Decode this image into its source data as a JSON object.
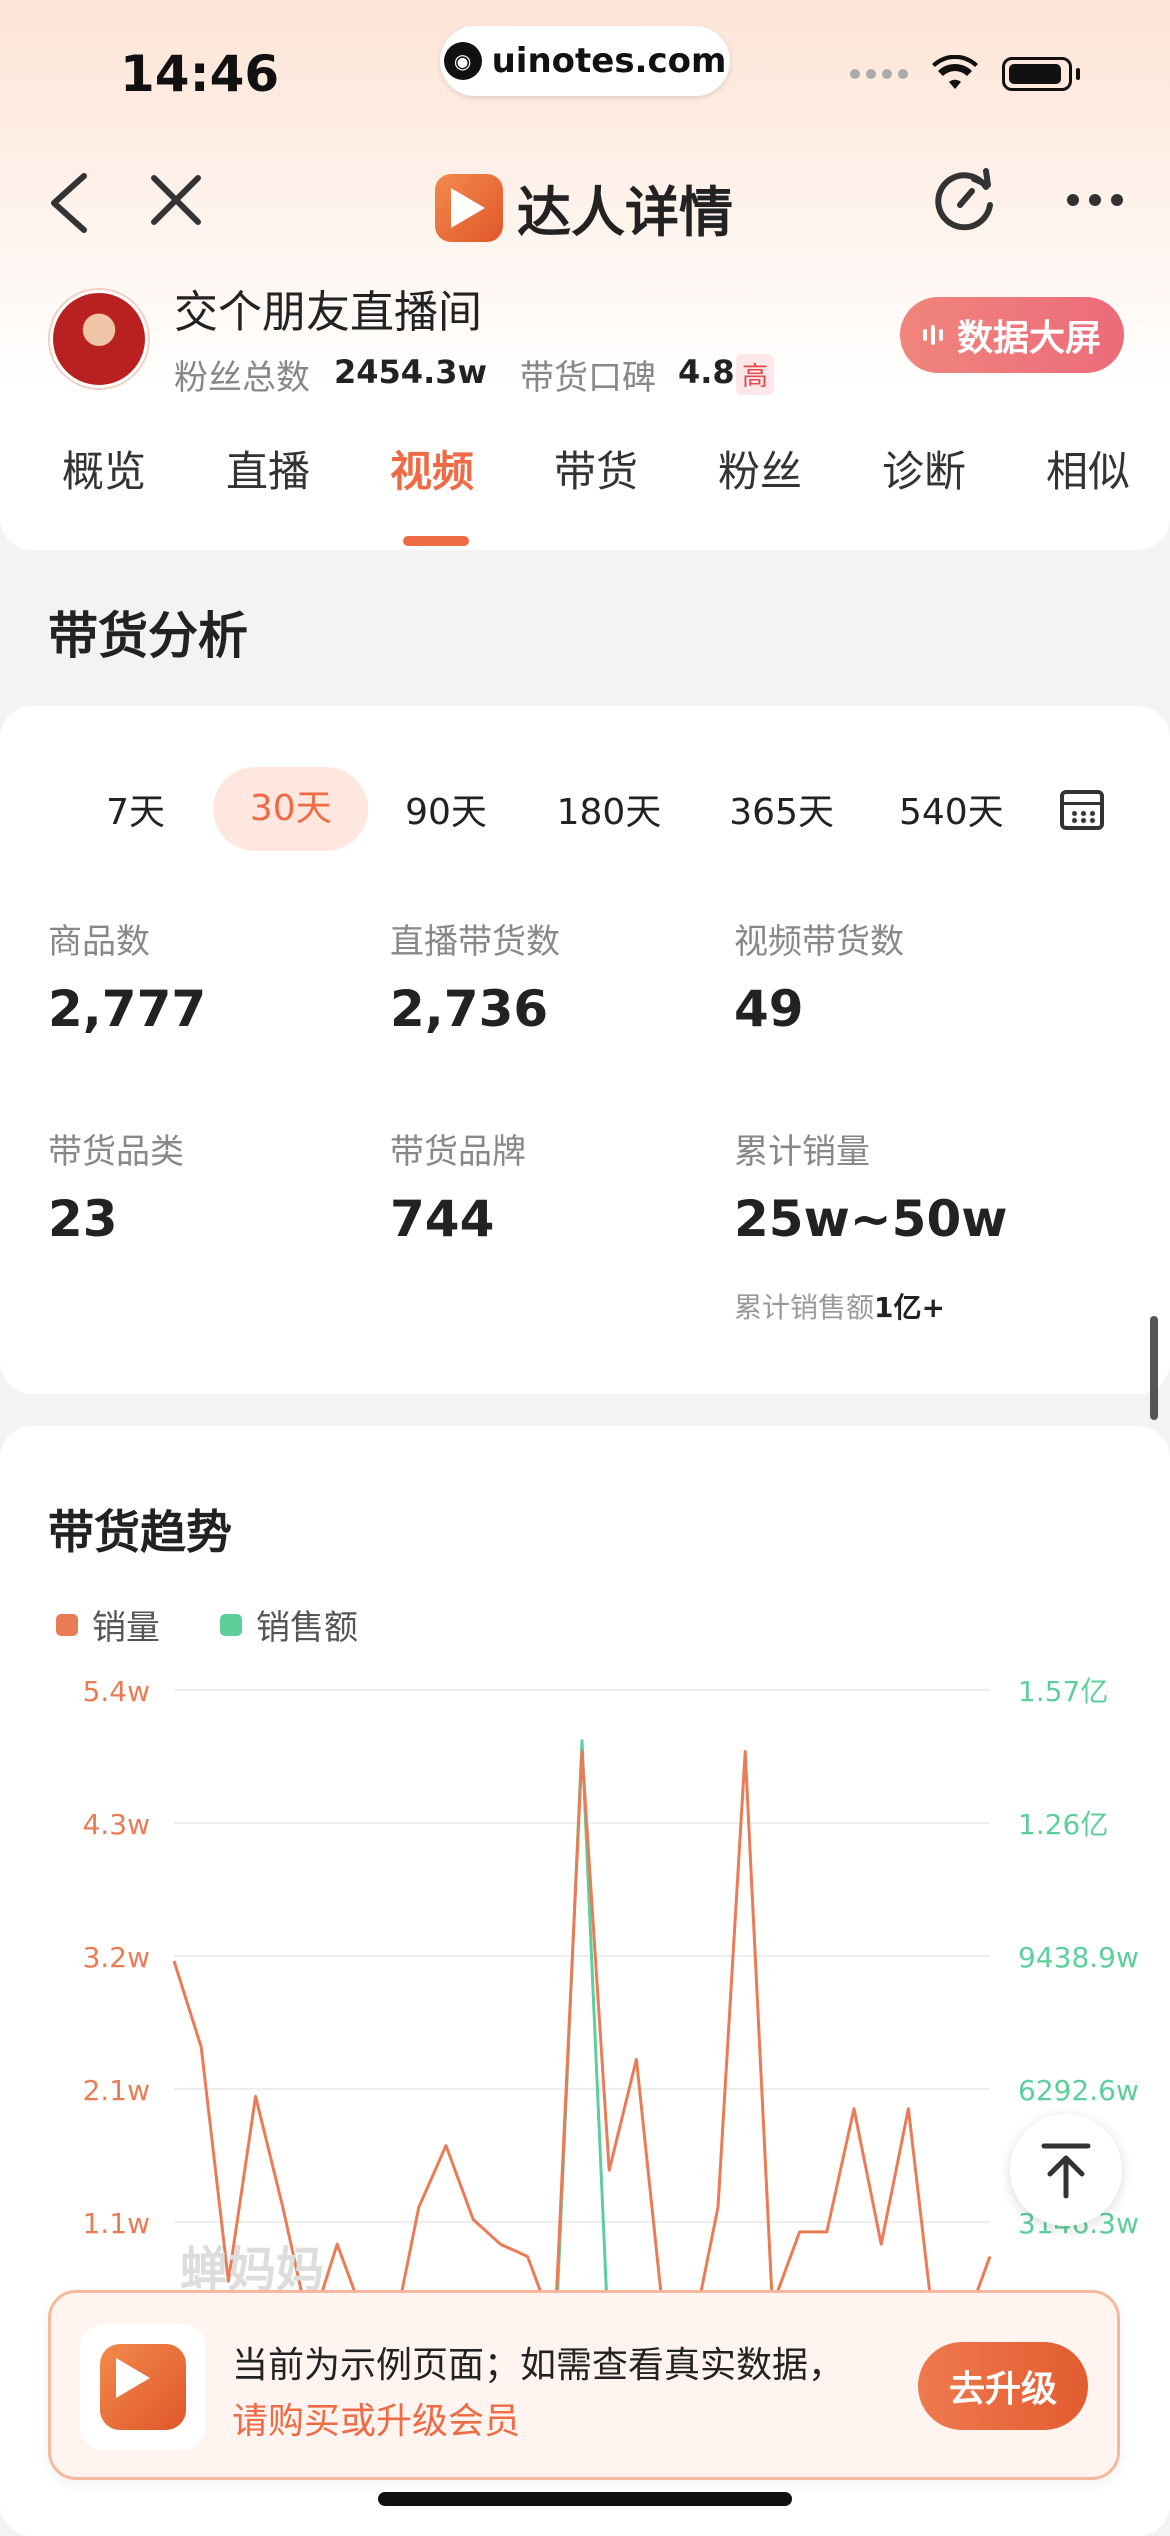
{
  "status_bar": {
    "time": "14:46",
    "url": "uinotes.com"
  },
  "nav": {
    "title": "达人详情"
  },
  "profile": {
    "name": "交个朋友直播间",
    "fans_label": "粉丝总数",
    "fans_value": "2454.3w",
    "rep_label": "带货口碑",
    "rep_value": "4.8",
    "rep_badge": "高",
    "screen_button": "数据大屏"
  },
  "tabs": [
    "概览",
    "直播",
    "视频",
    "带货",
    "粉丝",
    "诊断",
    "相似"
  ],
  "section_title": "带货分析",
  "periods": [
    "7天",
    "30天",
    "90天",
    "180天",
    "365天",
    "540天"
  ],
  "stats": [
    {
      "label": "商品数",
      "value": "2,777"
    },
    {
      "label": "直播带货数",
      "value": "2,736"
    },
    {
      "label": "视频带货数",
      "value": "49"
    },
    {
      "label": "带货品类",
      "value": "23"
    },
    {
      "label": "带货品牌",
      "value": "744"
    },
    {
      "label": "累计销量",
      "value": "25w~50w"
    }
  ],
  "cumulative_sales_label": "累计销售额",
  "cumulative_sales_value": "1亿+",
  "trend": {
    "title": "带货趋势",
    "legend": [
      "销量",
      "销售额"
    ],
    "colors": {
      "volume": "#ea7c55",
      "amount": "#5ccf9b"
    }
  },
  "chart_data": {
    "type": "line",
    "y_left_ticks": [
      "5.4w",
      "4.3w",
      "3.2w",
      "2.1w",
      "1.1w"
    ],
    "y_right_ticks": [
      "1.57亿",
      "1.26亿",
      "9438.9w",
      "6292.6w",
      "3146.3w"
    ],
    "series": [
      {
        "name": "销量",
        "values": [
          3.2,
          2.5,
          0.6,
          2.1,
          1.2,
          0.2,
          0.9,
          0.3,
          0.1,
          1.2,
          1.7,
          1.1,
          0.9,
          0.8,
          0.2,
          4.9,
          1.5,
          2.4,
          0.3,
          0.1,
          1.2,
          4.9,
          0.4,
          1.0,
          1.0,
          2.0,
          0.9,
          2.0,
          0.1,
          0.2,
          0.8
        ]
      },
      {
        "name": "销售额",
        "values": [
          0,
          0,
          0,
          0,
          0,
          0,
          0,
          0,
          0,
          0,
          0,
          0,
          0,
          0,
          0,
          1.45,
          0,
          0,
          0,
          0,
          0,
          0,
          0,
          0,
          0,
          0,
          0,
          0,
          0.14,
          0.06,
          0
        ]
      }
    ],
    "ylim_left": [
      0,
      5.4
    ],
    "ylim_right": [
      0,
      1.57
    ]
  },
  "watermark": "蝉妈妈",
  "banner": {
    "line1": "当前为示例页面；如需查看真实数据，",
    "line2": "请购买或升级会员",
    "button": "去升级"
  }
}
